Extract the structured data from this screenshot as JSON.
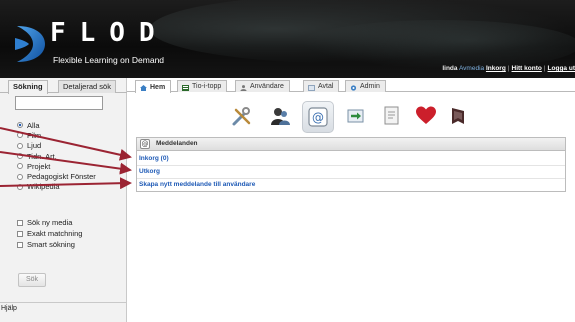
{
  "header": {
    "logo_text": "FLOD",
    "logo_subtitle": "Flexible Learning on Demand",
    "user_name": "linda",
    "app_name": "Avmedia",
    "links": [
      "Inkorg",
      "Hitt konto",
      "Logga ut"
    ],
    "separator": "|"
  },
  "sidebar": {
    "tabs": [
      "Sökning",
      "Detaljerad sök"
    ],
    "search_value": "",
    "media_types": [
      {
        "label": "Alla",
        "checked": true
      },
      {
        "label": "Film",
        "checked": false
      },
      {
        "label": "Ljud",
        "checked": false
      },
      {
        "label": "Tidn. Art.",
        "checked": false
      },
      {
        "label": "Projekt",
        "checked": false
      },
      {
        "label": "Pedagogiskt Fönster",
        "checked": false
      },
      {
        "label": "Wikipedia",
        "checked": false
      }
    ],
    "options": [
      {
        "label": "Sök ny media",
        "checked": false
      },
      {
        "label": "Exakt matchning",
        "checked": false
      },
      {
        "label": "Smart sökning",
        "checked": false
      }
    ],
    "search_button": "Sök",
    "help": "Hjälp"
  },
  "main_tabs": [
    {
      "label": "Hem",
      "icon": "home-icon"
    },
    {
      "label": "Tio-i-topp",
      "icon": "top-ten-icon"
    },
    {
      "label": "Användare",
      "icon": "user-icon"
    },
    {
      "label": "Avtal",
      "icon": "agreement-icon"
    },
    {
      "label": "Admin",
      "icon": "admin-icon"
    }
  ],
  "toolbar": [
    "tools-icon",
    "users-icon",
    "message-icon",
    "export-icon",
    "document-icon",
    "favorites-icon",
    "bookmark-icon"
  ],
  "messages": {
    "title": "Meddelanden",
    "links": [
      "Inkorg (0)",
      "Utkorg",
      "Skapa nytt meddelande till användare"
    ]
  },
  "colors": {
    "link": "#1e5ab6",
    "arrow": "#9b2433",
    "header_bg": "#111111"
  }
}
